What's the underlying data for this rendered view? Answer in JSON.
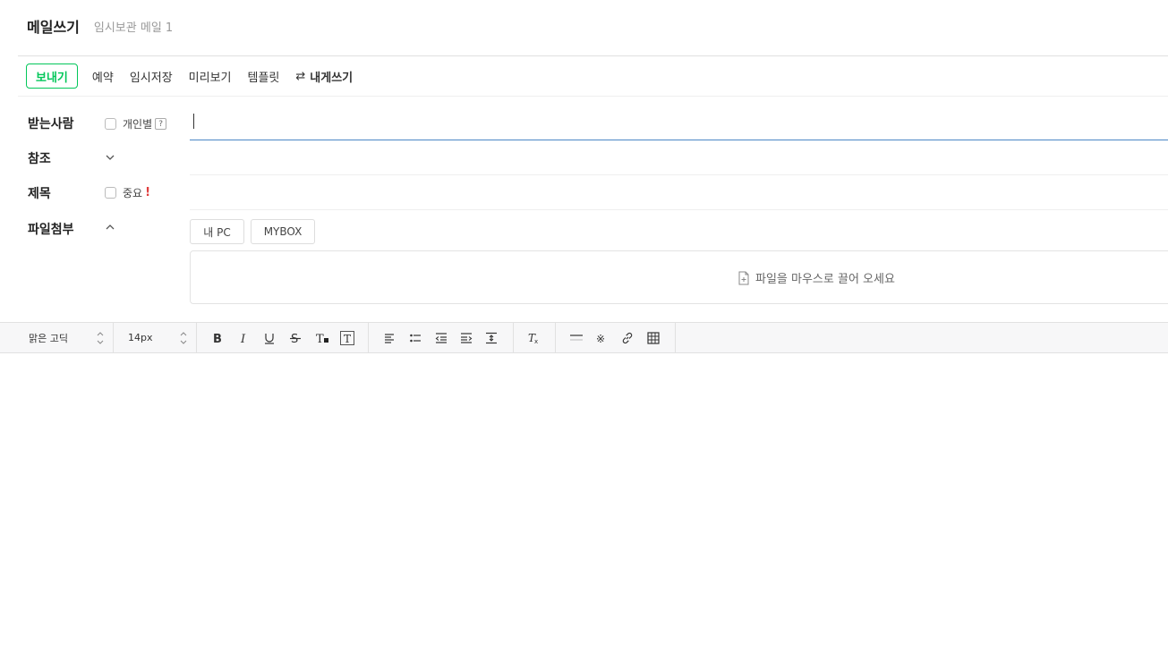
{
  "header": {
    "title": "메일쓰기",
    "draft_status": "임시보관 메일 1"
  },
  "toolbar": {
    "send_label": "보내기",
    "schedule_label": "예약",
    "save_draft_label": "임시저장",
    "preview_label": "미리보기",
    "template_label": "템플릿",
    "self_mail_label": "내게쓰기",
    "self_mail_icon": "swap-arrows-icon"
  },
  "fields": {
    "to_label": "받는사람",
    "individual_label": "개인별",
    "help_label": "?",
    "cc_label": "참조",
    "subject_label": "제목",
    "important_label": "중요",
    "important_mark": "!",
    "attach_label": "파일첨부"
  },
  "attach": {
    "mypc_label": "내 PC",
    "mybox_label": "MYBOX",
    "drop_text": "파일을 마우스로 끌어 오세요"
  },
  "editor": {
    "font_family": "맑은 고딕",
    "font_size": "14px"
  }
}
